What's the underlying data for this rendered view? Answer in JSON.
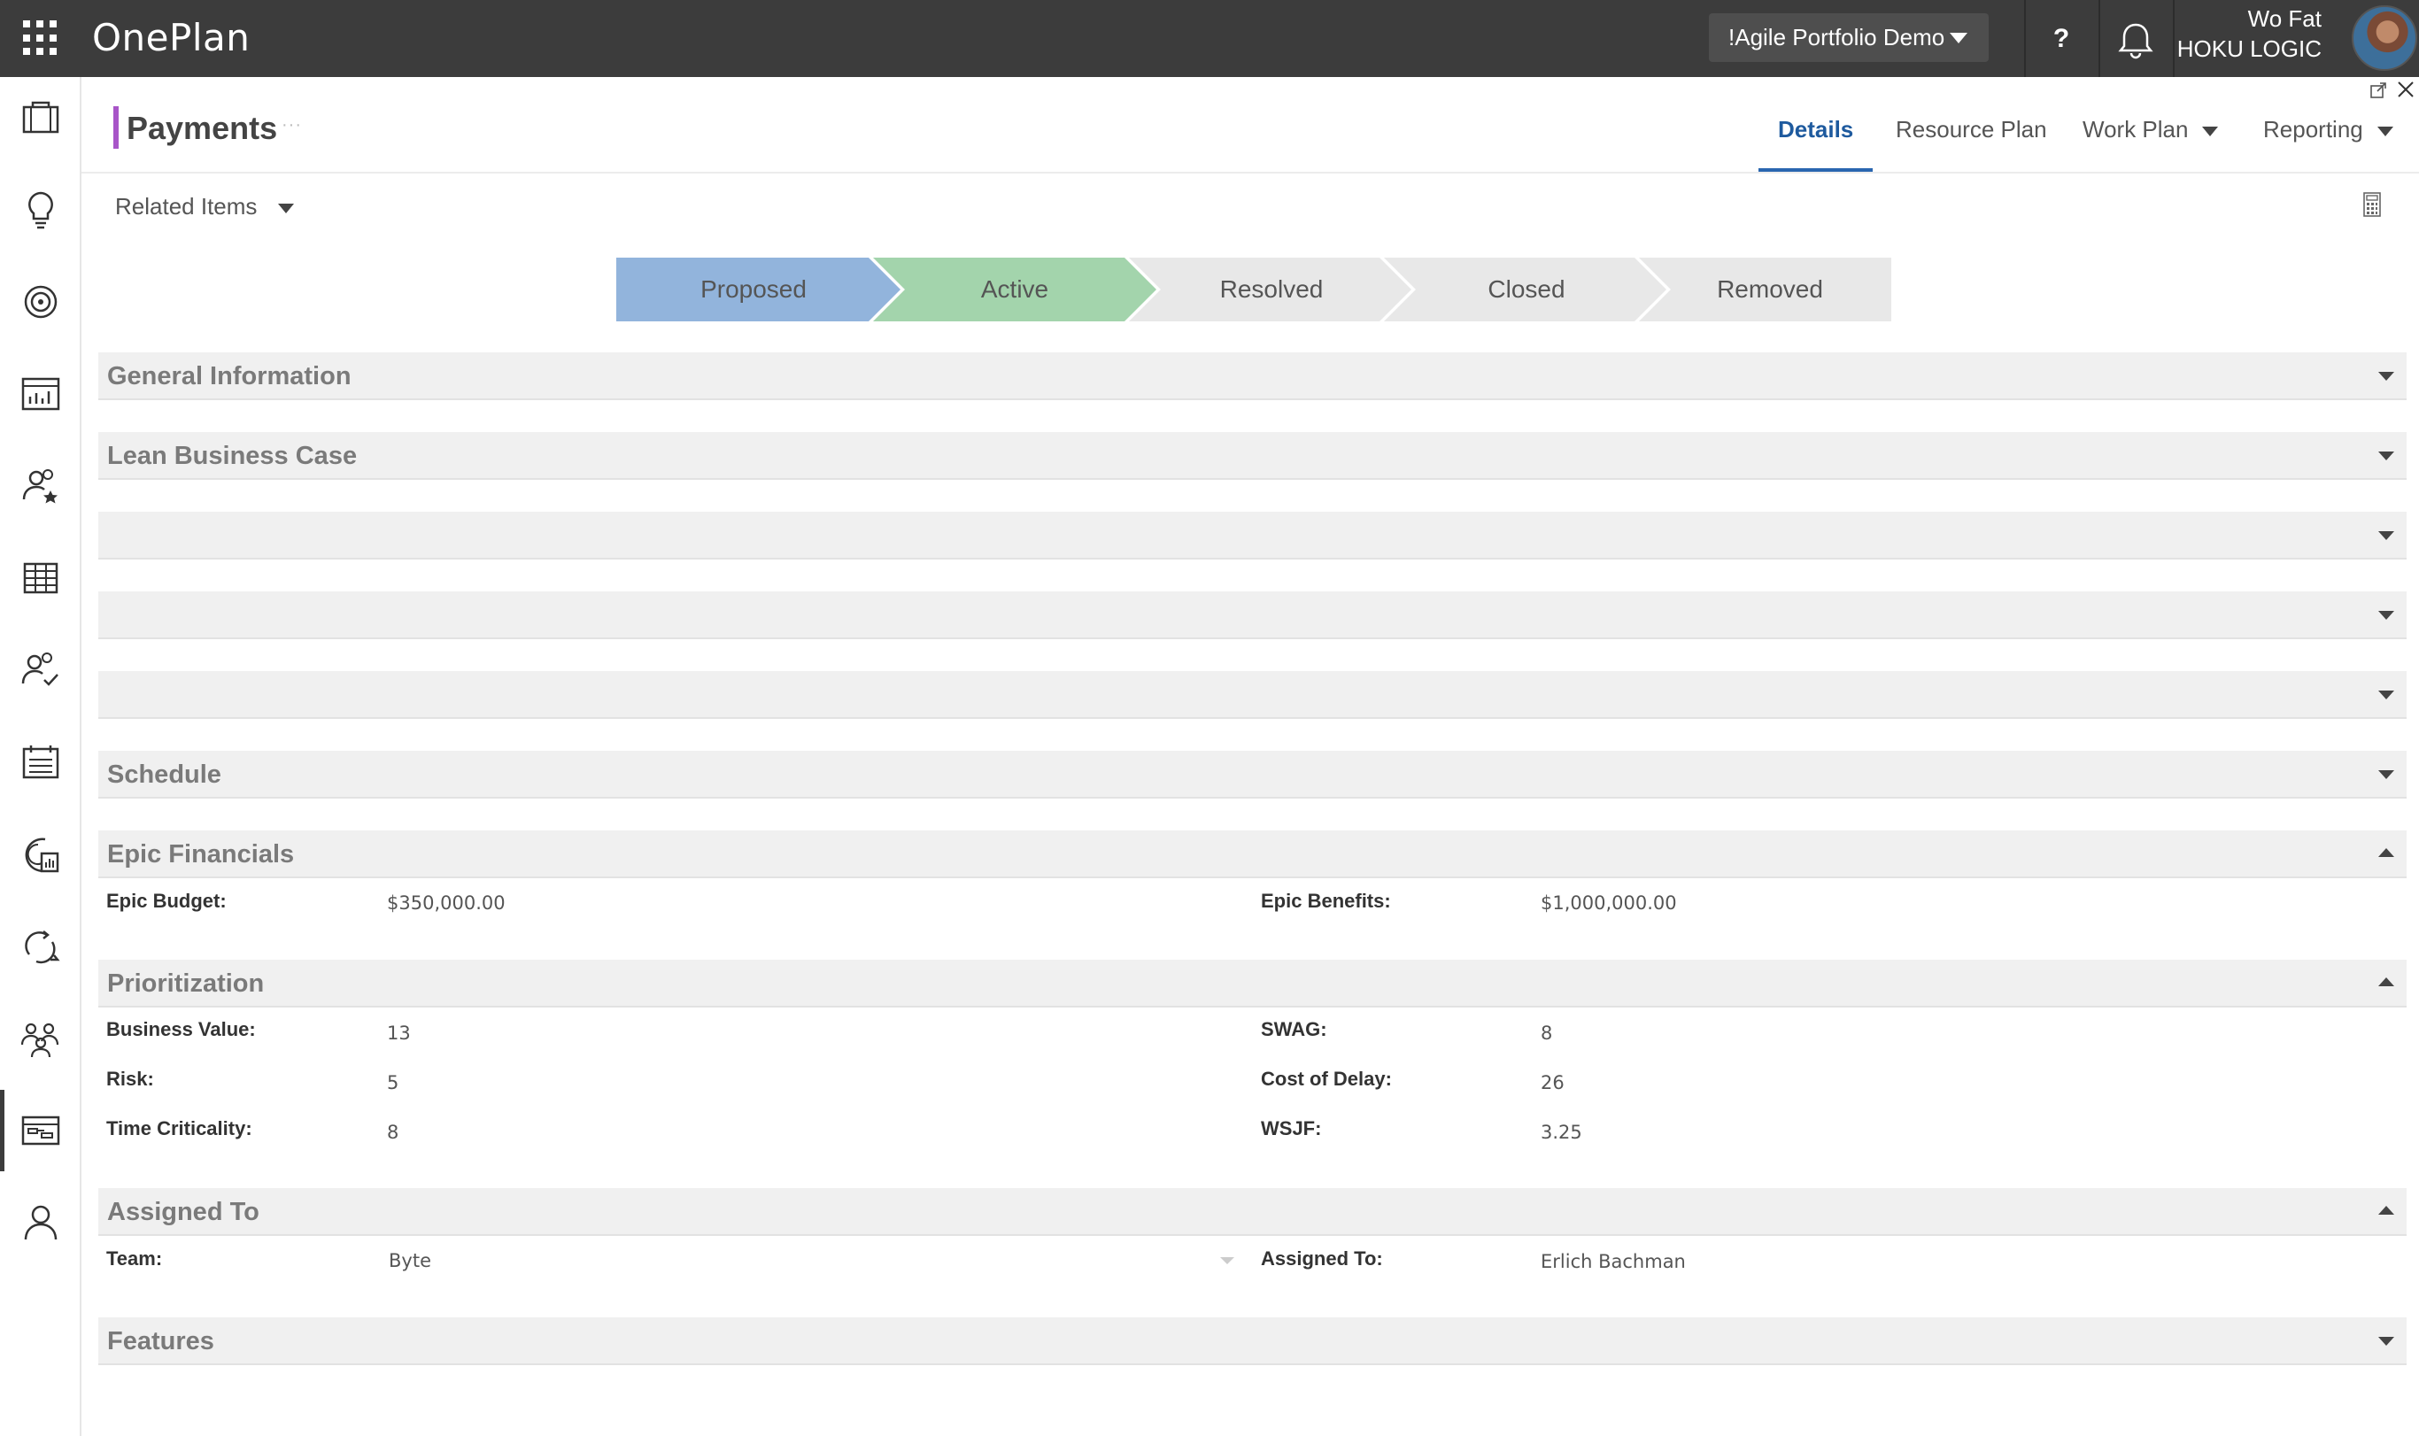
{
  "app": {
    "title": "OnePlan"
  },
  "topbar": {
    "portfolio": "!Agile Portfolio Demo",
    "help_label": "?",
    "user_name": "Wo Fat",
    "user_org": "HOKU LOGIC"
  },
  "rail": {
    "items": [
      {
        "icon": "briefcase-icon"
      },
      {
        "icon": "lightbulb-icon"
      },
      {
        "icon": "target-icon"
      },
      {
        "icon": "dashboard-chart-icon"
      },
      {
        "icon": "people-star-icon"
      },
      {
        "icon": "grid-table-icon"
      },
      {
        "icon": "people-check-icon"
      },
      {
        "icon": "calendar-list-icon"
      },
      {
        "icon": "globe-report-icon"
      },
      {
        "icon": "cycle-arrow-icon"
      },
      {
        "icon": "team-icon"
      },
      {
        "icon": "board-icon",
        "active": true
      },
      {
        "icon": "person-icon"
      }
    ]
  },
  "page": {
    "title": "Payments",
    "more": "···",
    "related_items": "Related Items"
  },
  "tabs": [
    {
      "label": "Details",
      "active": true
    },
    {
      "label": "Resource Plan"
    },
    {
      "label": "Work Plan",
      "dropdown": true
    },
    {
      "label": "Reporting",
      "dropdown": true
    }
  ],
  "stages": [
    {
      "label": "Proposed",
      "color": "#92b4dc",
      "state": "complete"
    },
    {
      "label": "Active",
      "color": "#a3d4ac",
      "state": "current"
    },
    {
      "label": "Resolved",
      "color": "#e8e8e8",
      "state": "pending"
    },
    {
      "label": "Closed",
      "color": "#e8e8e8",
      "state": "pending"
    },
    {
      "label": "Removed",
      "color": "#e8e8e8",
      "state": "pending"
    }
  ],
  "sections": [
    {
      "label": "General Information",
      "expanded": false
    },
    {
      "label": "Lean Business Case",
      "expanded": false
    },
    {
      "label": "",
      "expanded": false
    },
    {
      "label": "",
      "expanded": false
    },
    {
      "label": "",
      "expanded": false
    },
    {
      "label": "Schedule",
      "expanded": false
    },
    {
      "label": "Epic Financials",
      "expanded": true
    },
    {
      "label": "Prioritization",
      "expanded": true
    },
    {
      "label": "Assigned To",
      "expanded": true
    },
    {
      "label": "Features",
      "expanded": false
    }
  ],
  "fields": {
    "epic_budget": {
      "label": "Epic Budget:",
      "value": "$350,000.00"
    },
    "epic_benefits": {
      "label": "Epic Benefits:",
      "value": "$1,000,000.00"
    },
    "business_value": {
      "label": "Business Value:",
      "value": "13"
    },
    "swag": {
      "label": "SWAG:",
      "value": "8"
    },
    "risk": {
      "label": "Risk:",
      "value": "5"
    },
    "cost_of_delay": {
      "label": "Cost of Delay:",
      "value": "26"
    },
    "time_criticality": {
      "label": "Time Criticality:",
      "value": "8"
    },
    "wsjf": {
      "label": "WSJF:",
      "value": "3.25"
    },
    "team": {
      "label": "Team:",
      "value": "Byte"
    },
    "assigned_to": {
      "label": "Assigned To:",
      "value": "Erlich Bachman"
    }
  }
}
